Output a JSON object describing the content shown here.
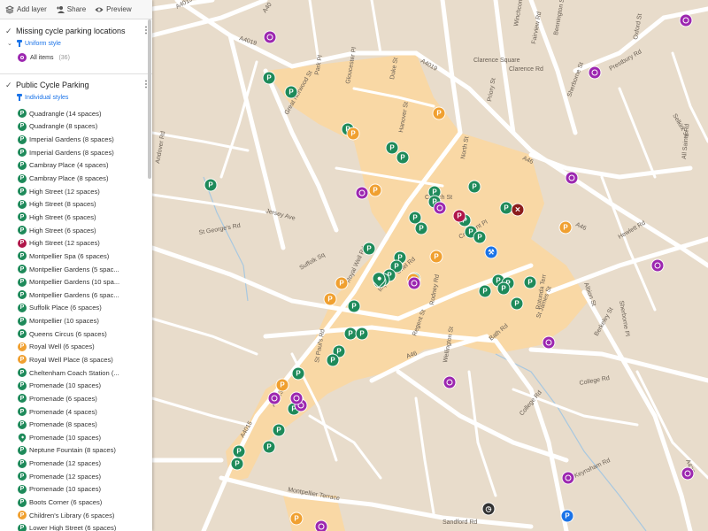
{
  "toolbar": {
    "add_layer": "Add layer",
    "share": "Share",
    "preview": "Preview"
  },
  "layers": [
    {
      "title": "Missing cycle parking locations",
      "style": "Uniform style",
      "all_items": "All items",
      "count": "(36)"
    },
    {
      "title": "Public Cycle Parking",
      "style": "Individual styles"
    }
  ],
  "colors": {
    "green": "#1e8a5a",
    "orange": "#f0a030",
    "red": "#b0174a",
    "purple": "#9c27b0",
    "blue": "#1a73e8",
    "dark_red": "#8b1c1c",
    "dark": "#333333",
    "map_bg": "#e8dccb",
    "map_zone": "#fbd7a1",
    "road": "#ffffff"
  },
  "items": [
    {
      "label": "Quadrangle (14 spaces)",
      "color": "green",
      "icon": "P"
    },
    {
      "label": "Quadrangle (8 spaces)",
      "color": "green",
      "icon": "P"
    },
    {
      "label": "Imperial Gardens (8 spaces)",
      "color": "green",
      "icon": "P"
    },
    {
      "label": "Imperial Gardens (8 spaces)",
      "color": "green",
      "icon": "P"
    },
    {
      "label": "Cambray Place (4 spaces)",
      "color": "green",
      "icon": "P"
    },
    {
      "label": "Cambray Place (8 spaces)",
      "color": "green",
      "icon": "P"
    },
    {
      "label": "High Street (12 spaces)",
      "color": "green",
      "icon": "P"
    },
    {
      "label": "High Street (8 spaces)",
      "color": "green",
      "icon": "P"
    },
    {
      "label": "High Street (6 spaces)",
      "color": "green",
      "icon": "P"
    },
    {
      "label": "High Street (6 spaces)",
      "color": "green",
      "icon": "P"
    },
    {
      "label": "High Street (12 spaces)",
      "color": "red",
      "icon": "P"
    },
    {
      "label": "Montpellier Spa (6 spaces)",
      "color": "green",
      "icon": "P"
    },
    {
      "label": "Montpellier Gardens (5 spac...",
      "color": "green",
      "icon": "P"
    },
    {
      "label": "Montpellier Gardens (10 spa...",
      "color": "green",
      "icon": "P"
    },
    {
      "label": "Montpellier Gardens (6 spac...",
      "color": "green",
      "icon": "P"
    },
    {
      "label": "Suffolk Place (6 spaces)",
      "color": "green",
      "icon": "P"
    },
    {
      "label": "Montpellier (10 spaces)",
      "color": "green",
      "icon": "P"
    },
    {
      "label": "Queens Circus (6 spaces)",
      "color": "green",
      "icon": "P"
    },
    {
      "label": "Royal Well (6 spaces)",
      "color": "orange",
      "icon": "P"
    },
    {
      "label": "Royal Well Place (8 spaces)",
      "color": "orange",
      "icon": "P"
    },
    {
      "label": "Cheltenham Coach Station (...",
      "color": "green",
      "icon": "P"
    },
    {
      "label": "Promenade (10 spaces)",
      "color": "green",
      "icon": "P"
    },
    {
      "label": "Promenade (6 spaces)",
      "color": "green",
      "icon": "P"
    },
    {
      "label": "Promenade (4 spaces)",
      "color": "green",
      "icon": "P"
    },
    {
      "label": "Promenade (8 spaces)",
      "color": "green",
      "icon": "P"
    },
    {
      "label": "Promenade (10 spaces)",
      "color": "green",
      "icon": "pin"
    },
    {
      "label": "Neptune Fountain (8 spaces)",
      "color": "green",
      "icon": "P"
    },
    {
      "label": "Promenade (12 spaces)",
      "color": "green",
      "icon": "P"
    },
    {
      "label": "Promenade (12 spaces)",
      "color": "green",
      "icon": "P"
    },
    {
      "label": "Promenade (10 spaces)",
      "color": "green",
      "icon": "P"
    },
    {
      "label": "Boots Corner (6 spaces)",
      "color": "green",
      "icon": "P"
    },
    {
      "label": "Children's Library (6 spaces)",
      "color": "orange",
      "icon": "P"
    },
    {
      "label": "Lower High Street (6 spaces)",
      "color": "green",
      "icon": "P"
    }
  ],
  "map": {
    "road_labels": [
      {
        "text": "A4019"
      },
      {
        "text": "A4019"
      },
      {
        "text": "A4019"
      },
      {
        "text": "A46"
      },
      {
        "text": "A46"
      },
      {
        "text": "A46"
      },
      {
        "text": "A40"
      },
      {
        "text": "A4015"
      },
      {
        "text": "A4013"
      },
      {
        "text": "A435"
      },
      {
        "text": "Montpellier Terrace"
      },
      {
        "text": "College Rd"
      },
      {
        "text": "College Rd"
      },
      {
        "text": "Bath Rd"
      },
      {
        "text": "North St"
      },
      {
        "text": "Albion St"
      },
      {
        "text": "Berkeley St"
      },
      {
        "text": "Royal Well Rd"
      },
      {
        "text": "Clarence Square"
      },
      {
        "text": "Prestbury Rd"
      },
      {
        "text": "Clarence Rd"
      },
      {
        "text": "Winchcombe St"
      },
      {
        "text": "Sherborne St"
      },
      {
        "text": "Fairview Rd"
      },
      {
        "text": "All Saints Rd"
      },
      {
        "text": "Hewlett Rd"
      },
      {
        "text": "Sandford Rd"
      },
      {
        "text": "Keynsham Rd"
      },
      {
        "text": "Oriel Rd"
      },
      {
        "text": "Regent St"
      },
      {
        "text": "Rodney Rd"
      },
      {
        "text": "Imperial Sq"
      },
      {
        "text": "Rotunda Terr"
      },
      {
        "text": "Priory St"
      },
      {
        "text": "St George's Rd"
      },
      {
        "text": "Jersey Ave"
      },
      {
        "text": "Church St"
      },
      {
        "text": "Bennington St"
      },
      {
        "text": "Selkirk St"
      },
      {
        "text": "Sherborne Pl"
      },
      {
        "text": "Wellington St"
      },
      {
        "text": "Suffolk Sq"
      },
      {
        "text": "Andover Rd"
      },
      {
        "text": "Great Norwood St"
      },
      {
        "text": "Park Pl"
      },
      {
        "text": "Gloucester Pl"
      },
      {
        "text": "Oxford St"
      },
      {
        "text": "Hanover St"
      },
      {
        "text": "Duke St"
      },
      {
        "text": "St Paul's Rd"
      },
      {
        "text": "Crescent Pl"
      },
      {
        "text": "St James St"
      }
    ],
    "markers": [
      {
        "type": "P",
        "color": "green"
      },
      {
        "type": "P",
        "color": "green"
      },
      {
        "type": "P",
        "color": "green"
      },
      {
        "type": "P",
        "color": "green"
      },
      {
        "type": "P",
        "color": "green"
      },
      {
        "type": "P",
        "color": "green"
      },
      {
        "type": "P",
        "color": "green"
      },
      {
        "type": "P",
        "color": "green"
      },
      {
        "type": "P",
        "color": "green"
      },
      {
        "type": "P",
        "color": "green"
      },
      {
        "type": "P",
        "color": "green"
      },
      {
        "type": "P",
        "color": "green"
      },
      {
        "type": "P",
        "color": "green"
      },
      {
        "type": "P",
        "color": "green"
      },
      {
        "type": "P",
        "color": "green"
      },
      {
        "type": "P",
        "color": "green"
      },
      {
        "type": "P",
        "color": "green"
      },
      {
        "type": "P",
        "color": "green"
      },
      {
        "type": "P",
        "color": "green"
      },
      {
        "type": "P",
        "color": "green"
      },
      {
        "type": "P",
        "color": "green"
      },
      {
        "type": "P",
        "color": "green"
      },
      {
        "type": "P",
        "color": "green"
      },
      {
        "type": "P",
        "color": "green"
      },
      {
        "type": "P",
        "color": "green"
      },
      {
        "type": "P",
        "color": "green"
      },
      {
        "type": "P",
        "color": "green"
      },
      {
        "type": "P",
        "color": "green"
      },
      {
        "type": "P",
        "color": "green"
      },
      {
        "type": "P",
        "color": "green"
      },
      {
        "type": "P",
        "color": "green"
      },
      {
        "type": "P",
        "color": "green"
      },
      {
        "type": "P",
        "color": "green"
      },
      {
        "type": "P",
        "color": "green"
      },
      {
        "type": "P",
        "color": "green"
      },
      {
        "type": "P",
        "color": "green"
      },
      {
        "type": "P",
        "color": "green"
      },
      {
        "type": "P",
        "color": "green"
      },
      {
        "type": "P",
        "color": "green"
      },
      {
        "type": "P",
        "color": "green"
      },
      {
        "type": "P",
        "color": "orange"
      },
      {
        "type": "P",
        "color": "orange"
      },
      {
        "type": "P",
        "color": "orange"
      },
      {
        "type": "P",
        "color": "orange"
      },
      {
        "type": "P",
        "color": "orange"
      },
      {
        "type": "P",
        "color": "orange"
      },
      {
        "type": "P",
        "color": "orange"
      },
      {
        "type": "P",
        "color": "orange"
      },
      {
        "type": "P",
        "color": "orange"
      },
      {
        "type": "P",
        "color": "orange"
      },
      {
        "type": "P",
        "color": "red"
      },
      {
        "type": "P",
        "color": "blue"
      },
      {
        "type": "circle",
        "color": "purple"
      },
      {
        "type": "circle",
        "color": "purple"
      },
      {
        "type": "circle",
        "color": "purple"
      },
      {
        "type": "circle",
        "color": "purple"
      },
      {
        "type": "circle",
        "color": "purple"
      },
      {
        "type": "circle",
        "color": "purple"
      },
      {
        "type": "circle",
        "color": "purple"
      },
      {
        "type": "circle",
        "color": "purple"
      },
      {
        "type": "circle",
        "color": "purple"
      },
      {
        "type": "circle",
        "color": "purple"
      },
      {
        "type": "circle",
        "color": "purple"
      },
      {
        "type": "circle",
        "color": "purple"
      },
      {
        "type": "circle",
        "color": "purple"
      },
      {
        "type": "circle",
        "color": "purple"
      },
      {
        "type": "circle",
        "color": "purple"
      },
      {
        "type": "circle",
        "color": "purple"
      },
      {
        "type": "wrench",
        "color": "blue"
      },
      {
        "type": "x",
        "color": "dark_red"
      },
      {
        "type": "clock",
        "color": "dark"
      },
      {
        "type": "pin",
        "color": "green"
      }
    ]
  }
}
